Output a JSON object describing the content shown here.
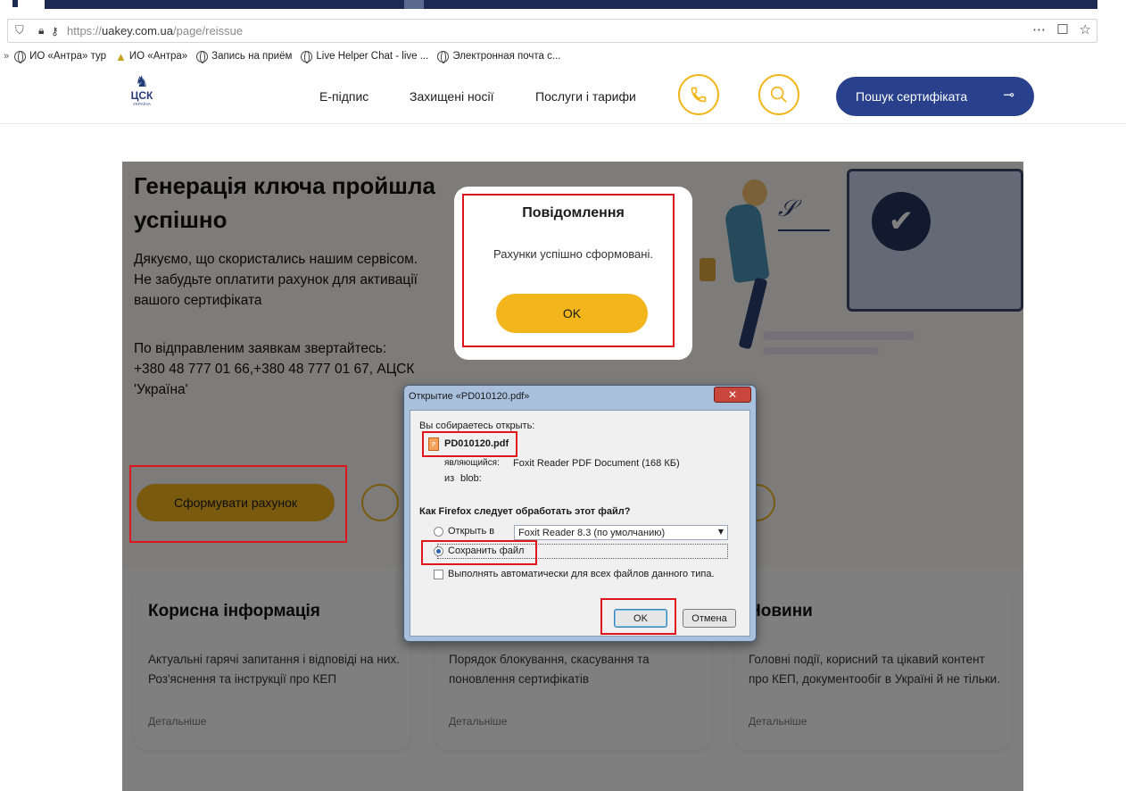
{
  "browser": {
    "url_domain": "uakey.com.ua",
    "url_scheme": "https://",
    "url_path": "/page/reissue",
    "bookmarks": [
      {
        "label": "ИО «Антра» тур"
      },
      {
        "label": "ИО «Антра»"
      },
      {
        "label": "Запись на приём"
      },
      {
        "label": "Live Helper Chat - live ..."
      },
      {
        "label": "Электронная почта с..."
      }
    ],
    "menu_icon": "⋯",
    "pocket_icon": "☐",
    "star_icon": "☆"
  },
  "header": {
    "logo_text": "ЦСК",
    "logo_subtext": "УКРАЇНА",
    "nav": [
      "Е-підпис",
      "Захищені носії",
      "Послуги і тарифи"
    ],
    "search_cert_label": "Пошук сертифіката"
  },
  "hero": {
    "title": "Генерація ключа пройшла успішно",
    "text1_line1": "Дякуємо, що скористались нашим сервісом.",
    "text1_line2": "Не забудьте оплатити рахунок для активації",
    "text1_line3": "вашого сертифіката",
    "text2_line1": "По відправленим заявкам звертайтесь:",
    "text2_line2": "+380 48 777 01 66,+380 48 777 01 67, АЦСК",
    "text2_line3": "'Україна'",
    "invoice_button": "Сформувати рахунок"
  },
  "cards": [
    {
      "title": "Корисна інформація",
      "text": "Актуальні гарячі запитання і відповіді на них. Роз'яснення та інструкції про КЕП",
      "more": "Детальніше"
    },
    {
      "title": "",
      "text": "Порядок блокування, скасування та поновлення сертифікатів",
      "more": "Детальніше"
    },
    {
      "title": "Новини",
      "text": "Головні події, корисний та цікавий контент про КЕП, документообіг в Україні й не тільки.",
      "more": "Детальніше"
    }
  ],
  "modal": {
    "title": "Повідомлення",
    "message": "Рахунки успішно сформовані.",
    "ok_label": "OK"
  },
  "download_dialog": {
    "title": "Открытие «PD010120.pdf»",
    "intro": "Вы собираетесь открыть:",
    "filename": "PD010120.pdf",
    "type_label": "являющийся:",
    "type_value": "Foxit Reader PDF Document (168 КБ)",
    "from_label": "из",
    "from_value": "blob:",
    "question": "Как Firefox следует обработать этот файл?",
    "open_with_label": "Открыть в",
    "open_with_value": "Foxit Reader 8.3 (по умолчанию)",
    "save_file_label": "Сохранить файл",
    "auto_label": "Выполнять автоматически для всех файлов данного типа.",
    "ok_label": "OK",
    "cancel_label": "Отмена",
    "selected_option": "save_file"
  },
  "colors": {
    "accent_yellow": "#f3b51c",
    "brand_blue": "#29418c",
    "annotation_red": "#e0141c"
  }
}
